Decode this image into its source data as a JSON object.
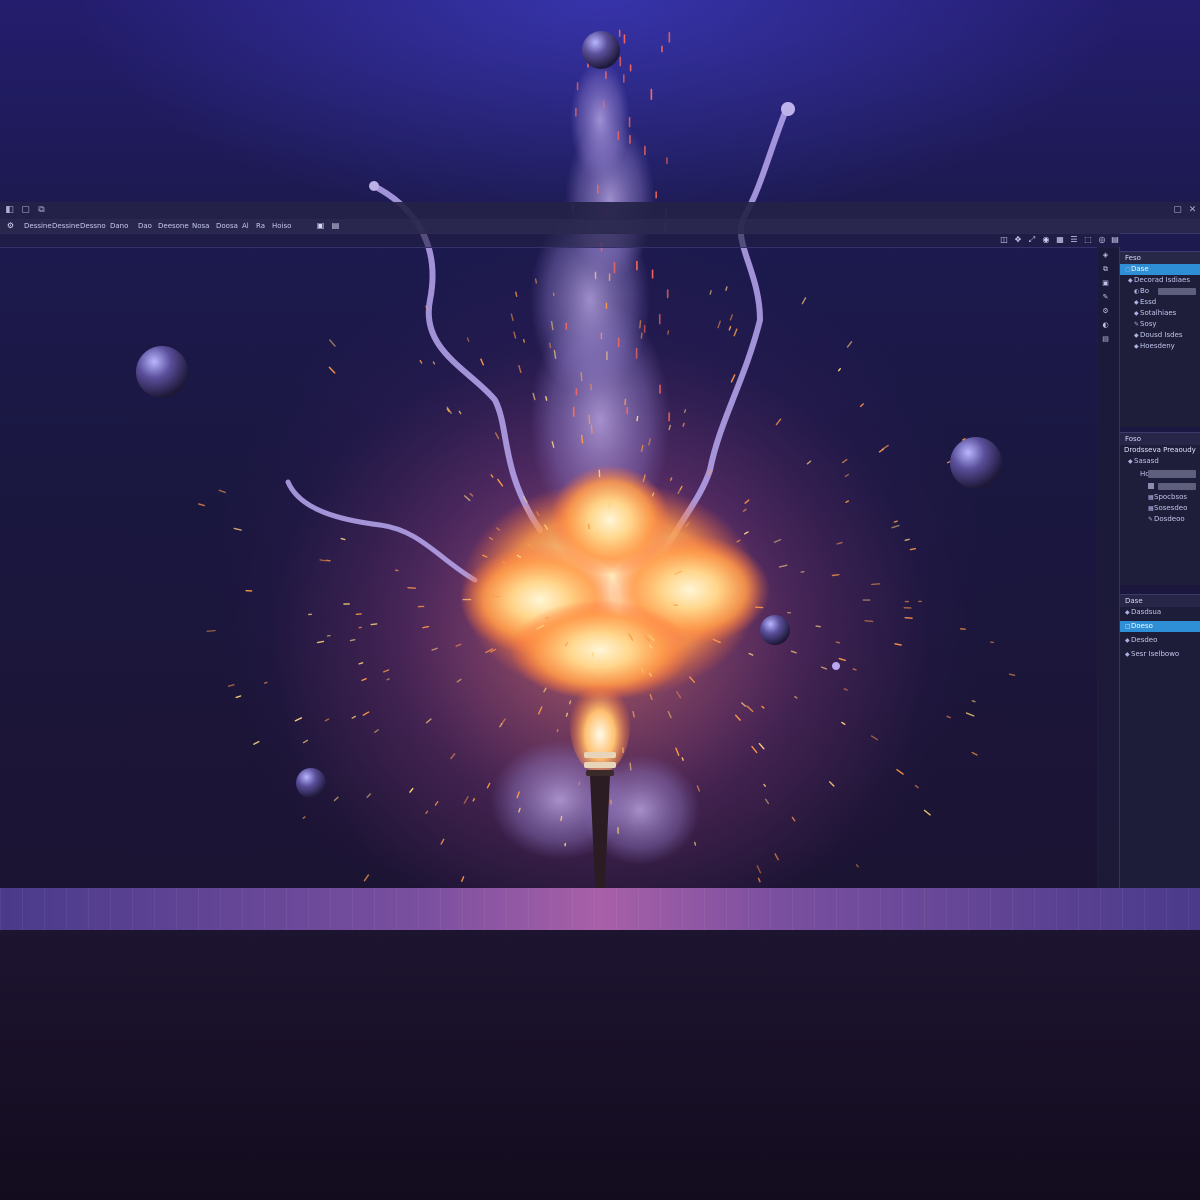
{
  "window": {
    "left_buttons": [
      "◧",
      "▢",
      "⧉"
    ],
    "right_buttons": [
      "▢",
      "✕"
    ]
  },
  "toolbar": {
    "items": [
      {
        "icon": "⚙",
        "label": ""
      },
      {
        "icon": "",
        "label": "Dessine"
      },
      {
        "icon": "",
        "label": "Dessine"
      },
      {
        "icon": "",
        "label": "Dessno"
      },
      {
        "icon": "",
        "label": "Dano"
      },
      {
        "icon": "",
        "label": "Dao"
      },
      {
        "icon": "",
        "label": "Deesone"
      },
      {
        "icon": "",
        "label": "Nosa"
      },
      {
        "icon": "",
        "label": "Doosa"
      },
      {
        "icon": "",
        "label": "Al"
      },
      {
        "icon": "",
        "label": "Ra"
      },
      {
        "icon": "",
        "label": "Hoiso"
      },
      {
        "icon": "▣",
        "label": ""
      },
      {
        "icon": "▤",
        "label": ""
      }
    ]
  },
  "viewport_tools": [
    "◫",
    "✥",
    "⤢",
    "◉",
    "▦",
    "☰",
    "⬚",
    "◎",
    "▤"
  ],
  "side_strip_icons": [
    "◈",
    "⧉",
    "▣",
    "✎",
    "⚙",
    "◐",
    "▤"
  ],
  "outliner": {
    "title": "Feso",
    "items": [
      {
        "label": "Dase",
        "selected": true,
        "indent": 0,
        "bullet": "▢"
      },
      {
        "label": "Decorad Isdiaes",
        "selected": false,
        "indent": 0,
        "bullet": "◆"
      },
      {
        "label": "Bo",
        "selected": false,
        "indent": 1,
        "bullet": "◐",
        "field": true
      },
      {
        "label": "Essd",
        "selected": false,
        "indent": 1,
        "bullet": "◆"
      },
      {
        "label": "Sotalhiaes",
        "selected": false,
        "indent": 1,
        "bullet": "◆"
      },
      {
        "label": "Sosy",
        "selected": false,
        "indent": 1,
        "bullet": "✎"
      },
      {
        "label": "Dousd Isdes",
        "selected": false,
        "indent": 1,
        "bullet": "◆"
      },
      {
        "label": "Hoesdeny",
        "selected": false,
        "indent": 1,
        "bullet": "◆"
      }
    ]
  },
  "properties": {
    "title": "Foso",
    "subtitle": "Drodsseva Preaoudy",
    "items": [
      {
        "label": "Sasasd",
        "indent": 0,
        "bullet": "◆"
      },
      {
        "label": "Hd",
        "indent": 1,
        "bullet": "",
        "field": true
      },
      {
        "label": "",
        "indent": 2,
        "bullet": "▦",
        "field": true
      },
      {
        "label": "Spocbsos",
        "indent": 2,
        "bullet": "▦"
      },
      {
        "label": "Sosesdeo",
        "indent": 2,
        "bullet": "▦"
      },
      {
        "label": "Dosdeoo",
        "indent": 2,
        "bullet": "✎"
      }
    ]
  },
  "layers": {
    "title": "Dase",
    "items": [
      {
        "label": "Dasdsua",
        "selected": false,
        "bullet": "◆"
      },
      {
        "label": "Doeso",
        "selected": true,
        "bullet": "▢"
      },
      {
        "label": "Desdeo",
        "selected": false,
        "bullet": "◆"
      },
      {
        "label": "Sesr Iselbowo",
        "selected": false,
        "bullet": "◆"
      }
    ]
  },
  "scene": {
    "fire_color": "#ffb060",
    "smoke_color": "#b49ce8",
    "orb_count": 6
  }
}
